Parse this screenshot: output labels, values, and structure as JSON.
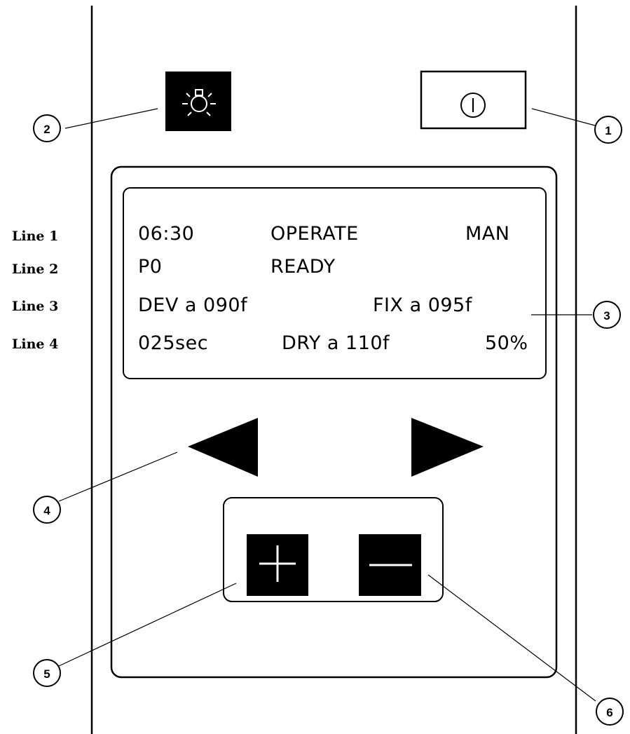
{
  "line_labels": [
    "Line 1",
    "Line 2",
    "Line 3",
    "Line 4"
  ],
  "display": {
    "line1": {
      "time": "06:30",
      "mode": "OPERATE",
      "control": "MAN"
    },
    "line2": {
      "program": "P0",
      "status": "READY"
    },
    "line3": {
      "dev": "DEV a 090f",
      "fix": "FIX a 095f"
    },
    "line4": {
      "time": "025sec",
      "dry": "DRY a 110f",
      "percent": "50%"
    }
  },
  "buttons": {
    "light_icon": "bulb-icon",
    "power_glyph": "I",
    "left_icon": "left-arrow-icon",
    "right_icon": "right-arrow-icon",
    "plus_icon": "plus-icon",
    "minus_icon": "minus-icon"
  },
  "callouts": [
    "1",
    "2",
    "3",
    "4",
    "5",
    "6"
  ]
}
